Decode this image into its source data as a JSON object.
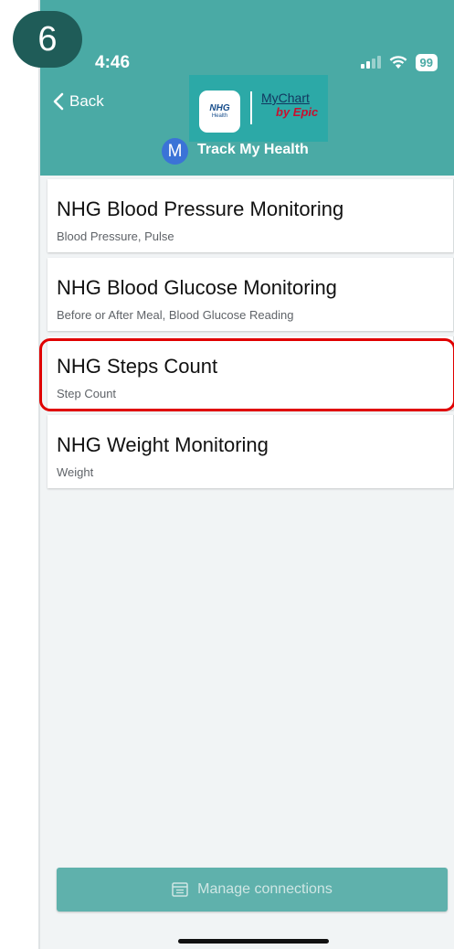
{
  "step_badge": "6",
  "status_bar": {
    "time": "4:46",
    "battery": "99"
  },
  "header": {
    "back_label": "Back",
    "logo": {
      "nhg_main": "NHG",
      "nhg_sub": "Health",
      "mychart": "MyChart",
      "epic": "by Epic"
    },
    "avatar_initial": "M",
    "title": "Track My Health"
  },
  "programs": [
    {
      "title": "NHG Blood Pressure Monitoring",
      "subtitle": "Blood Pressure, Pulse"
    },
    {
      "title": "NHG Blood Glucose Monitoring",
      "subtitle": "Before or After Meal, Blood Glucose Reading"
    },
    {
      "title": "NHG Steps Count",
      "subtitle": "Step Count"
    },
    {
      "title": "NHG Weight Monitoring",
      "subtitle": "Weight"
    }
  ],
  "footer": {
    "manage_label": "Manage connections"
  },
  "colors": {
    "header_teal": "#4aaaa5",
    "badge": "#1f5c58",
    "highlight": "#e00000",
    "button": "#5fb1ac"
  }
}
